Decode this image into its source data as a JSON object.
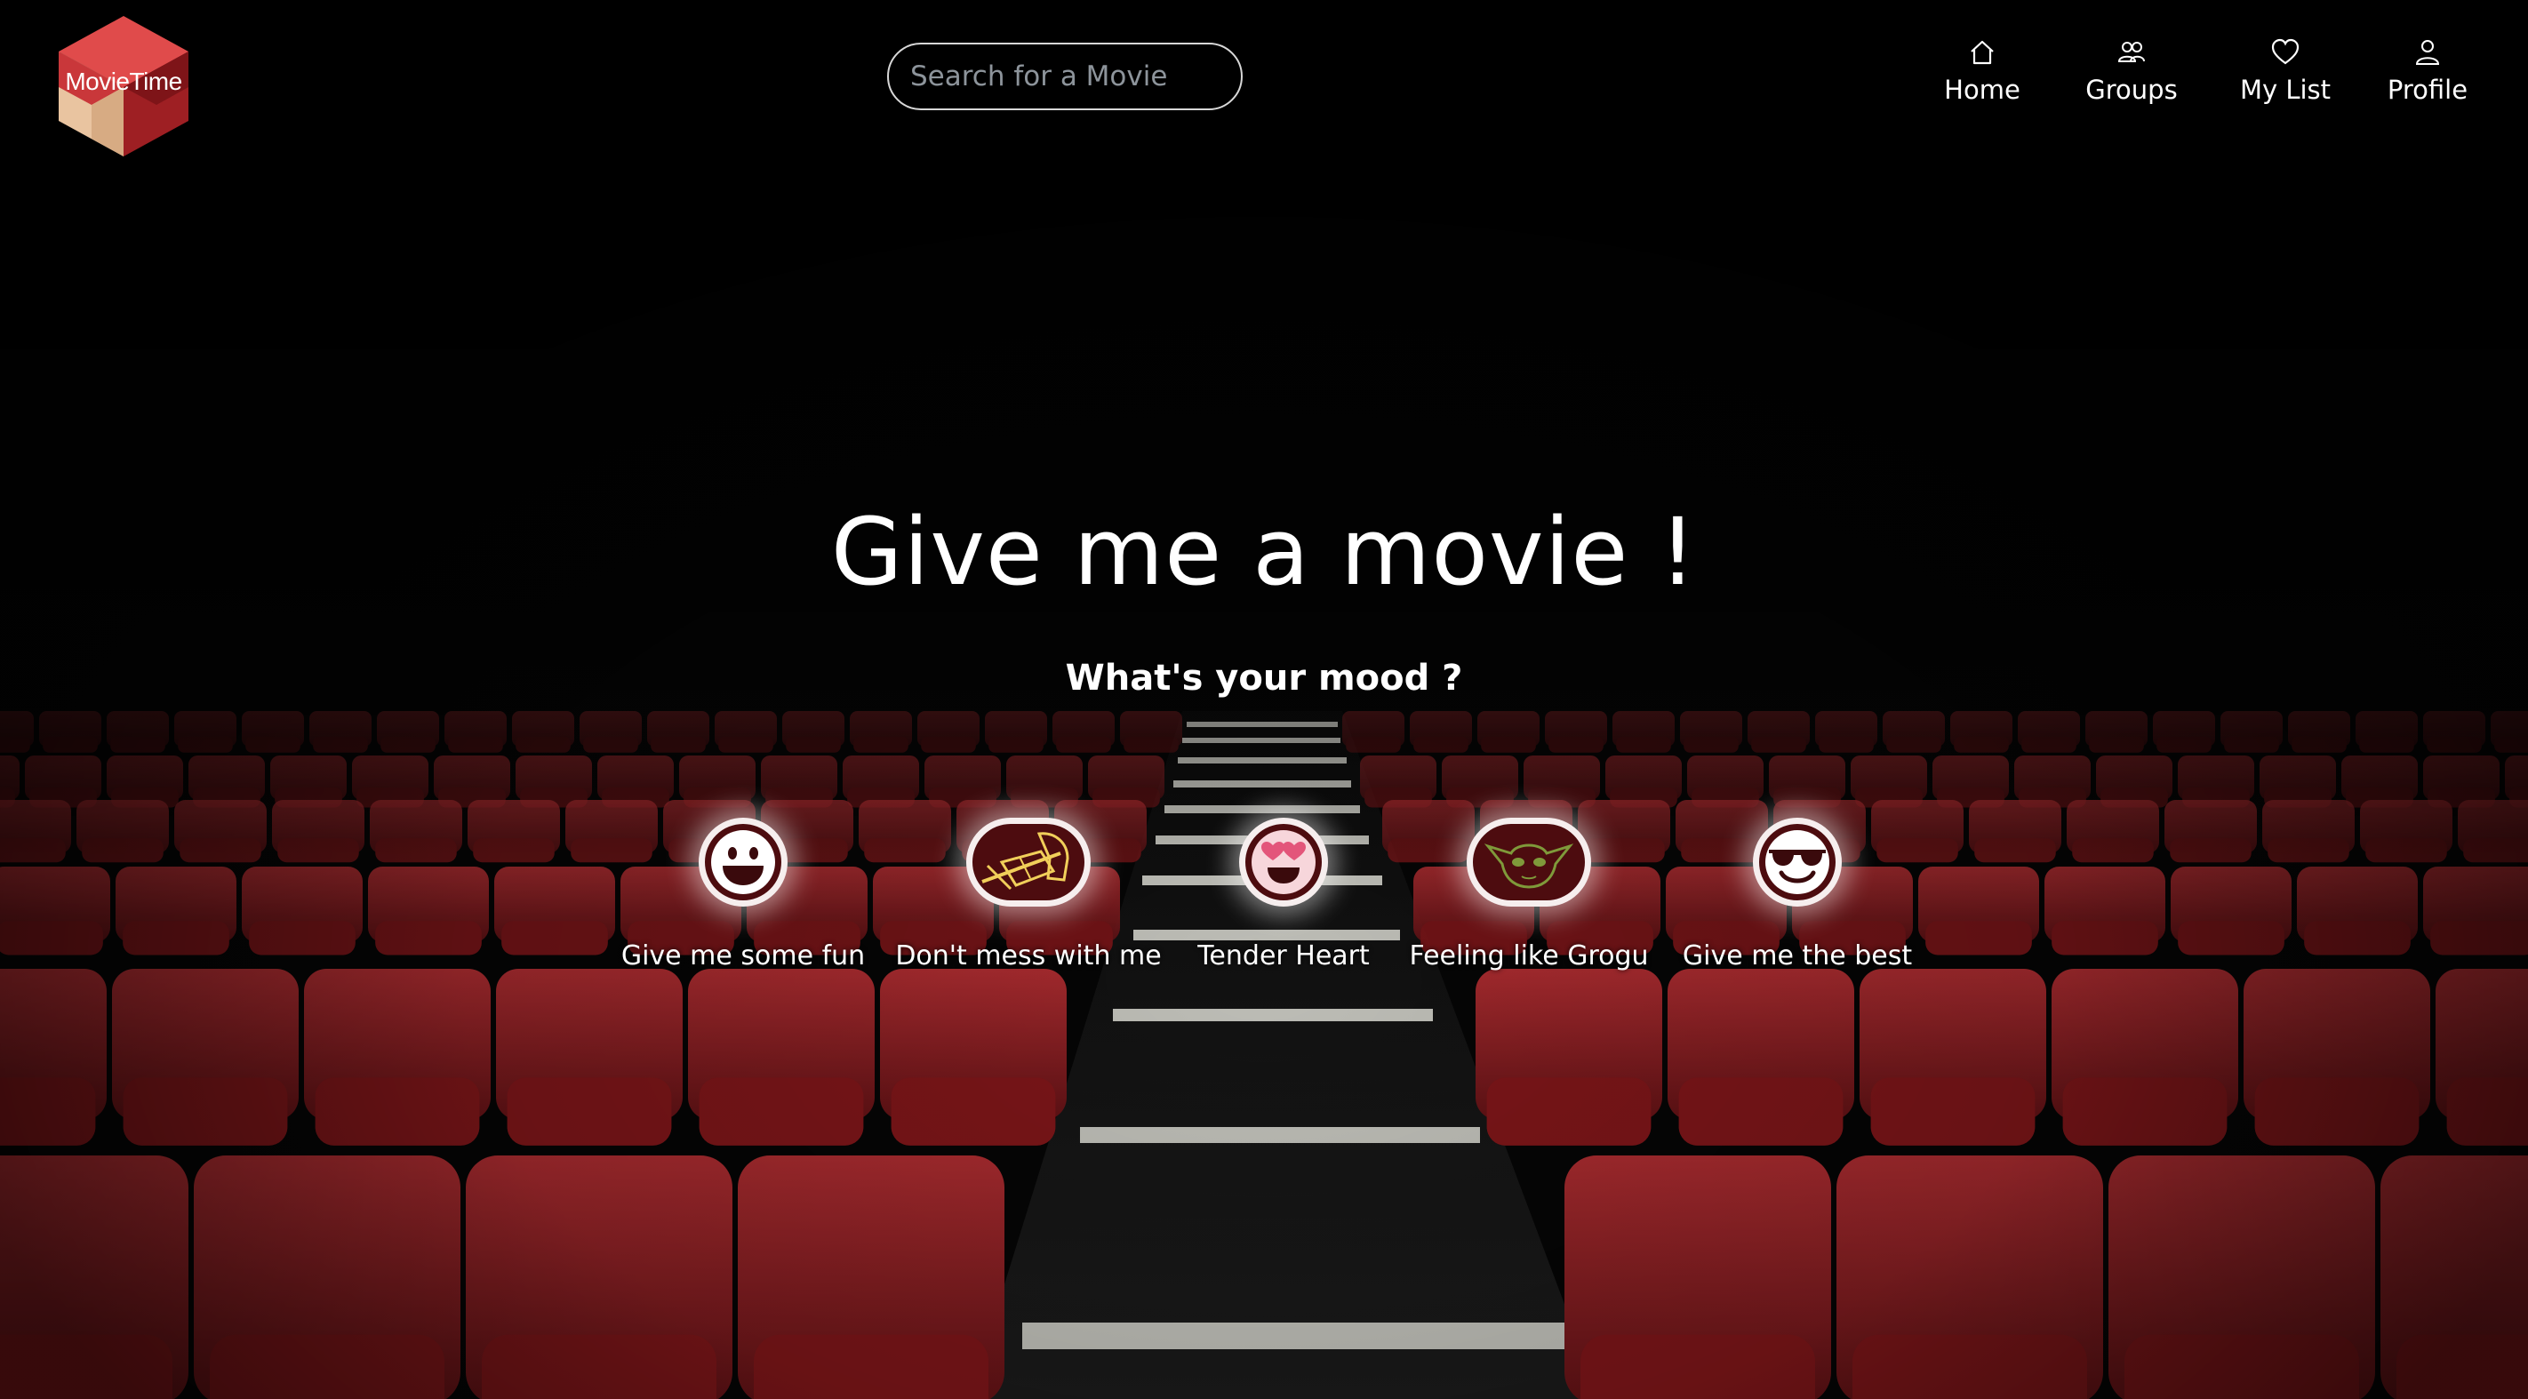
{
  "app": {
    "logo_text": "MovieTime"
  },
  "colors": {
    "accent": "#c0282d",
    "seat_red": "#8e1c20",
    "badge_bg": "#4d0c0f",
    "background": "#000000"
  },
  "search": {
    "placeholder": "Search for a Movie",
    "value": ""
  },
  "nav": {
    "items": [
      {
        "label": "Home",
        "icon": "home-icon"
      },
      {
        "label": "Groups",
        "icon": "groups-icon"
      },
      {
        "label": "My List",
        "icon": "heart-icon"
      },
      {
        "label": "Profile",
        "icon": "profile-icon"
      }
    ]
  },
  "hero": {
    "title": "Give me a movie !",
    "subtitle": "What's your mood ?"
  },
  "moods": [
    {
      "label": "Give me some fun",
      "icon": "grinning-face-icon"
    },
    {
      "label": "Don't mess with me",
      "icon": "kill-bill-icon"
    },
    {
      "label": "Tender Heart",
      "icon": "heart-eyes-face-icon"
    },
    {
      "label": "Feeling like Grogu",
      "icon": "grogu-icon"
    },
    {
      "label": "Give me the best",
      "icon": "sunglasses-face-icon"
    }
  ]
}
